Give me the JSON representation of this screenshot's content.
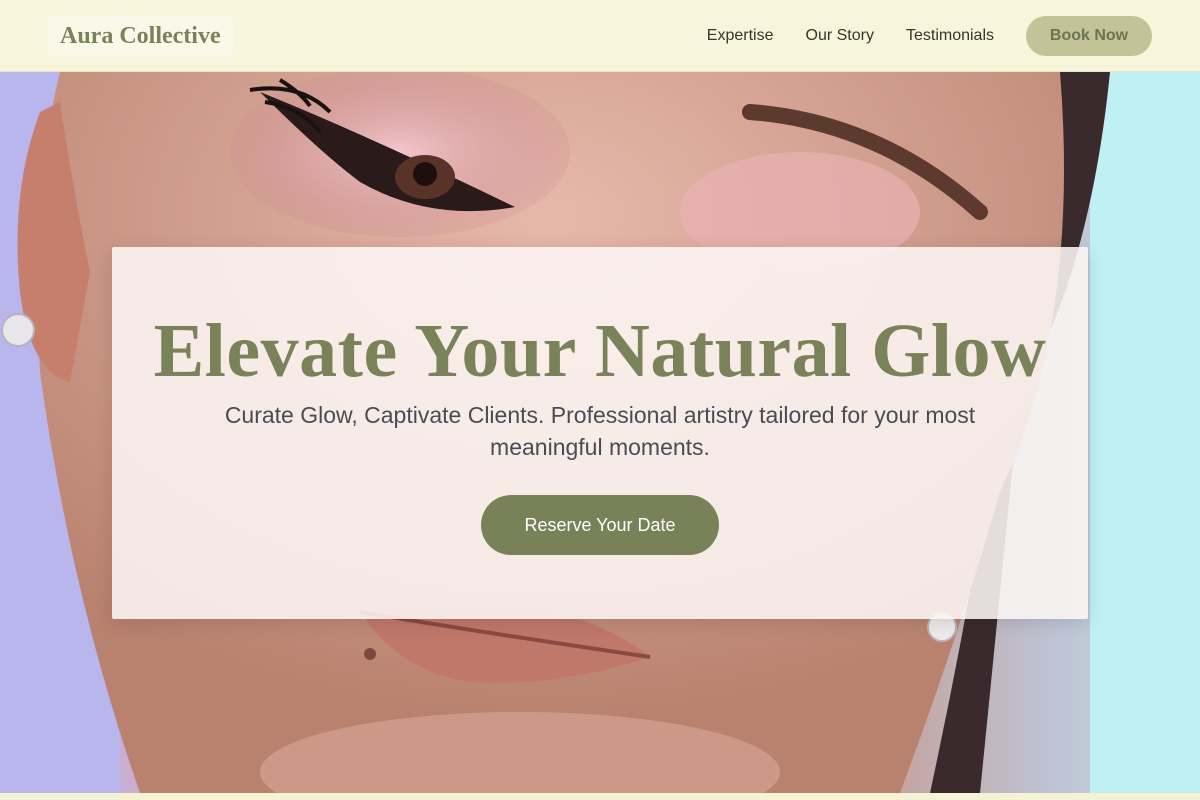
{
  "header": {
    "logo": "Aura Collective",
    "nav": [
      {
        "label": "Expertise"
      },
      {
        "label": "Our Story"
      },
      {
        "label": "Testimonials"
      }
    ],
    "book_label": "Book Now"
  },
  "hero": {
    "headline": "Elevate Your Natural Glow",
    "subhead": "Curate Glow, Captivate Clients. Professional artistry tailored for your most meaningful moments.",
    "cta_label": "Reserve Your Date"
  },
  "colors": {
    "accent": "#788157",
    "header_bg": "#f7f6dc",
    "book_button_bg": "#c3c398"
  }
}
